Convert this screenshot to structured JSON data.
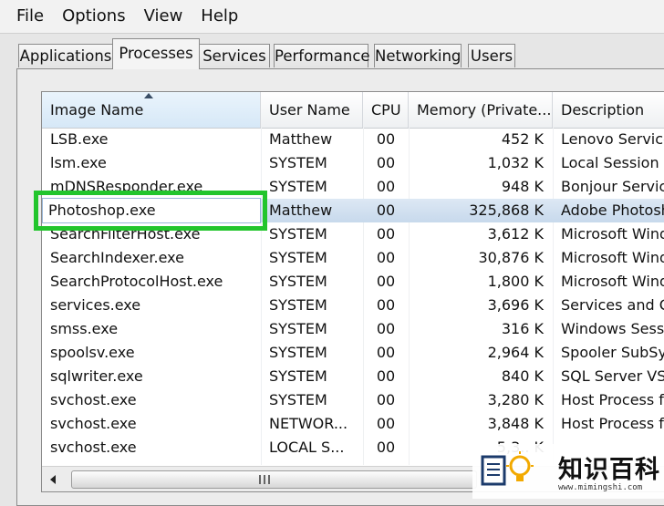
{
  "menu": [
    "File",
    "Options",
    "View",
    "Help"
  ],
  "tabs": [
    "Applications",
    "Processes",
    "Services",
    "Performance",
    "Networking",
    "Users"
  ],
  "active_tab": "Processes",
  "columns": [
    "Image Name",
    "User Name",
    "CPU",
    "Memory (Private...",
    "Description"
  ],
  "rows": [
    {
      "name": "LSB.exe",
      "user": "Matthew",
      "cpu": "00",
      "memory": "452 K",
      "description": "Lenovo Service"
    },
    {
      "name": "lsm.exe",
      "user": "SYSTEM",
      "cpu": "00",
      "memory": "1,032 K",
      "description": "Local Session M"
    },
    {
      "name": "mDNSResponder.exe",
      "user": "SYSTEM",
      "cpu": "00",
      "memory": "948 K",
      "description": "Bonjour Service"
    },
    {
      "name": "Photoshop.exe",
      "user": "Matthew",
      "cpu": "00",
      "memory": "325,868 K",
      "description": "Adobe Photosh"
    },
    {
      "name": "SearchFilterHost.exe",
      "user": "SYSTEM",
      "cpu": "00",
      "memory": "3,612 K",
      "description": "Microsoft Windo"
    },
    {
      "name": "SearchIndexer.exe",
      "user": "SYSTEM",
      "cpu": "00",
      "memory": "30,876 K",
      "description": "Microsoft Windo"
    },
    {
      "name": "SearchProtocolHost.exe",
      "user": "SYSTEM",
      "cpu": "00",
      "memory": "1,800 K",
      "description": "Microsoft Windo"
    },
    {
      "name": "services.exe",
      "user": "SYSTEM",
      "cpu": "00",
      "memory": "3,696 K",
      "description": "Services and Co"
    },
    {
      "name": "smss.exe",
      "user": "SYSTEM",
      "cpu": "00",
      "memory": "316 K",
      "description": "Windows Sessio"
    },
    {
      "name": "spoolsv.exe",
      "user": "SYSTEM",
      "cpu": "00",
      "memory": "2,964 K",
      "description": "Spooler SubSys"
    },
    {
      "name": "sqlwriter.exe",
      "user": "SYSTEM",
      "cpu": "00",
      "memory": "840 K",
      "description": "SQL Server VSS"
    },
    {
      "name": "svchost.exe",
      "user": "SYSTEM",
      "cpu": "00",
      "memory": "3,280 K",
      "description": "Host Process fo"
    },
    {
      "name": "svchost.exe",
      "user": "NETWOR...",
      "cpu": "00",
      "memory": "3,848 K",
      "description": "Host Process fo"
    },
    {
      "name": "svchost.exe",
      "user": "LOCAL S...",
      "cpu": "00",
      "memory": "5,3.. K",
      "description": ""
    }
  ],
  "selected_row_index": 3,
  "highlight": {
    "label": "Photoshop.exe",
    "color": "#22c52c"
  },
  "watermark": {
    "text": "知识百科",
    "url": "www.mimingshi.com"
  },
  "colors": {
    "selection": "#c7d9ec",
    "sorted_header": "#d6e8f7"
  }
}
